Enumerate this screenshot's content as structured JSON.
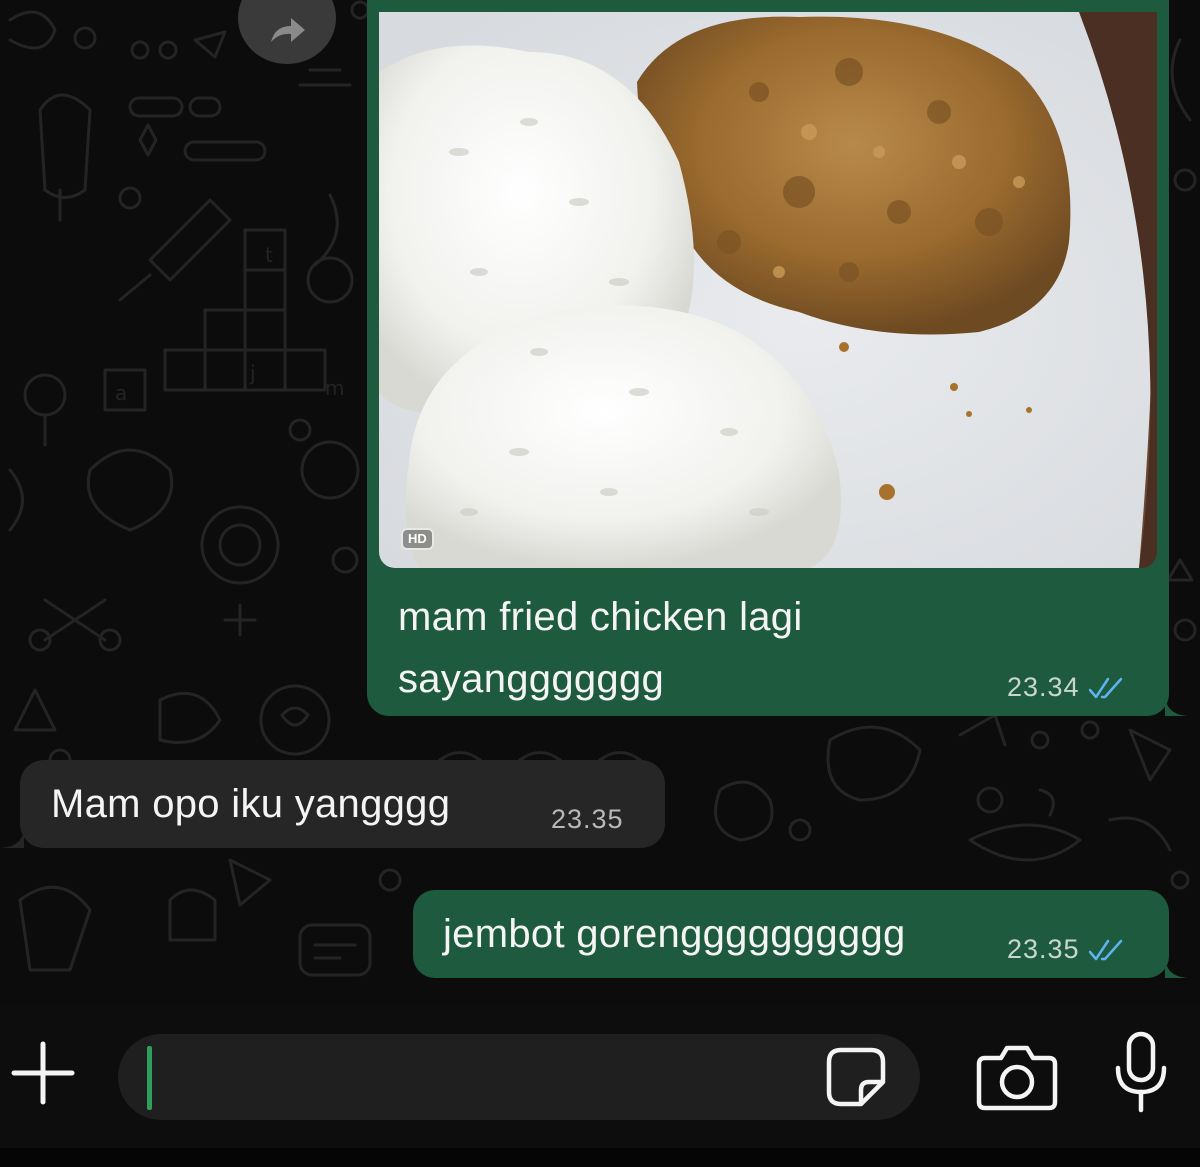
{
  "messages": [
    {
      "direction": "outgoing",
      "type": "image",
      "badge": "HD",
      "caption_line1": "mam fried chicken lagi",
      "caption_line2": "sayanggggggg",
      "time": "23.34",
      "status": "read"
    },
    {
      "direction": "incoming",
      "type": "text",
      "text": "Mam opo iku yangggg",
      "time": "23.35"
    },
    {
      "direction": "outgoing",
      "type": "text",
      "text": "jembot goreng​ggggggggg",
      "time": "23.35",
      "status": "read"
    }
  ],
  "composer": {
    "value": "",
    "placeholder": ""
  },
  "icons": {
    "forward": "forward-icon",
    "plus": "plus-icon",
    "sticker": "sticker-icon",
    "camera": "camera-icon",
    "mic": "microphone-icon",
    "read_receipt": "double-check-icon"
  },
  "colors": {
    "outgoing_bubble": "#1e5a3e",
    "incoming_bubble": "#262626",
    "background": "#0c0c0c",
    "read_check": "#5db4f0",
    "cursor": "#2fa05c"
  }
}
